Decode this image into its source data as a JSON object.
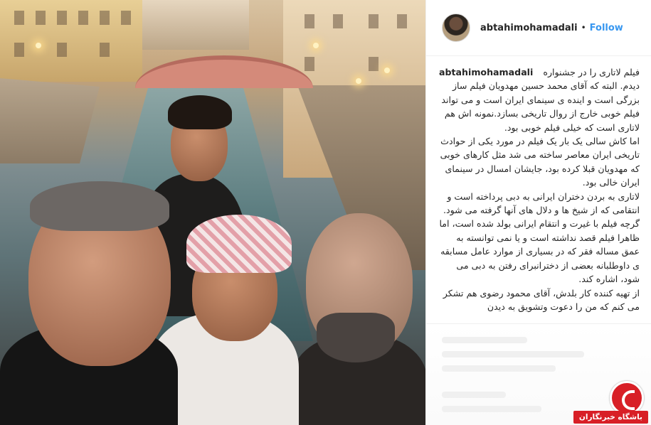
{
  "post": {
    "author": "abtahimohamadali",
    "separator": "•",
    "follow_label": "Follow",
    "caption": "فیلم لاتاری را در جشنواره دیدم. البته که آقای محمد حسین مهدویان فیلم ساز بزرگی است و اینده ی سینمای ایران است و می تواند فیلم خوبی خارج از روال تاریخی بسازد.نمونه اش هم لاتاری است که خیلی فیلم خوبی بود.\nاما کاش سالی یک بار یک فیلم در مورد یکی از حوادث تاریخی ایران معاصر ساخته می شد مثل کارهای خوبی که مهدویان قبلا کرده بود، جایشان امسال در سینمای ایران خالی بود.\nلاتاری به بردن دختران ایرانی به دبی پرداخته است و انتقامی که از شیخ ها و دلال های آنها گرفته می شود. گرچه فیلم با غیرت و انتقام ایرانی بولد شده است، اما ظاهرا فیلم قصد نداشته است و یا نمی توانسته به عمق مساله فقر که در بسیاری از موارد عامل مسابقه ی داوطلبانه بعضی از دخترانبرای رفتن به دبی می شود، اشاره کند.\nاز تهیه کننده کار بلدش، آقای محمود رضوی هم تشکر می کنم که من را دعوت وتشویق به دیدن"
  },
  "watermark": {
    "text": "باشگاه خبرنگاران",
    "icon": "yjc-logo-icon",
    "color": "#d81f26"
  },
  "colors": {
    "follow": "#3897f0",
    "text": "#262626"
  }
}
